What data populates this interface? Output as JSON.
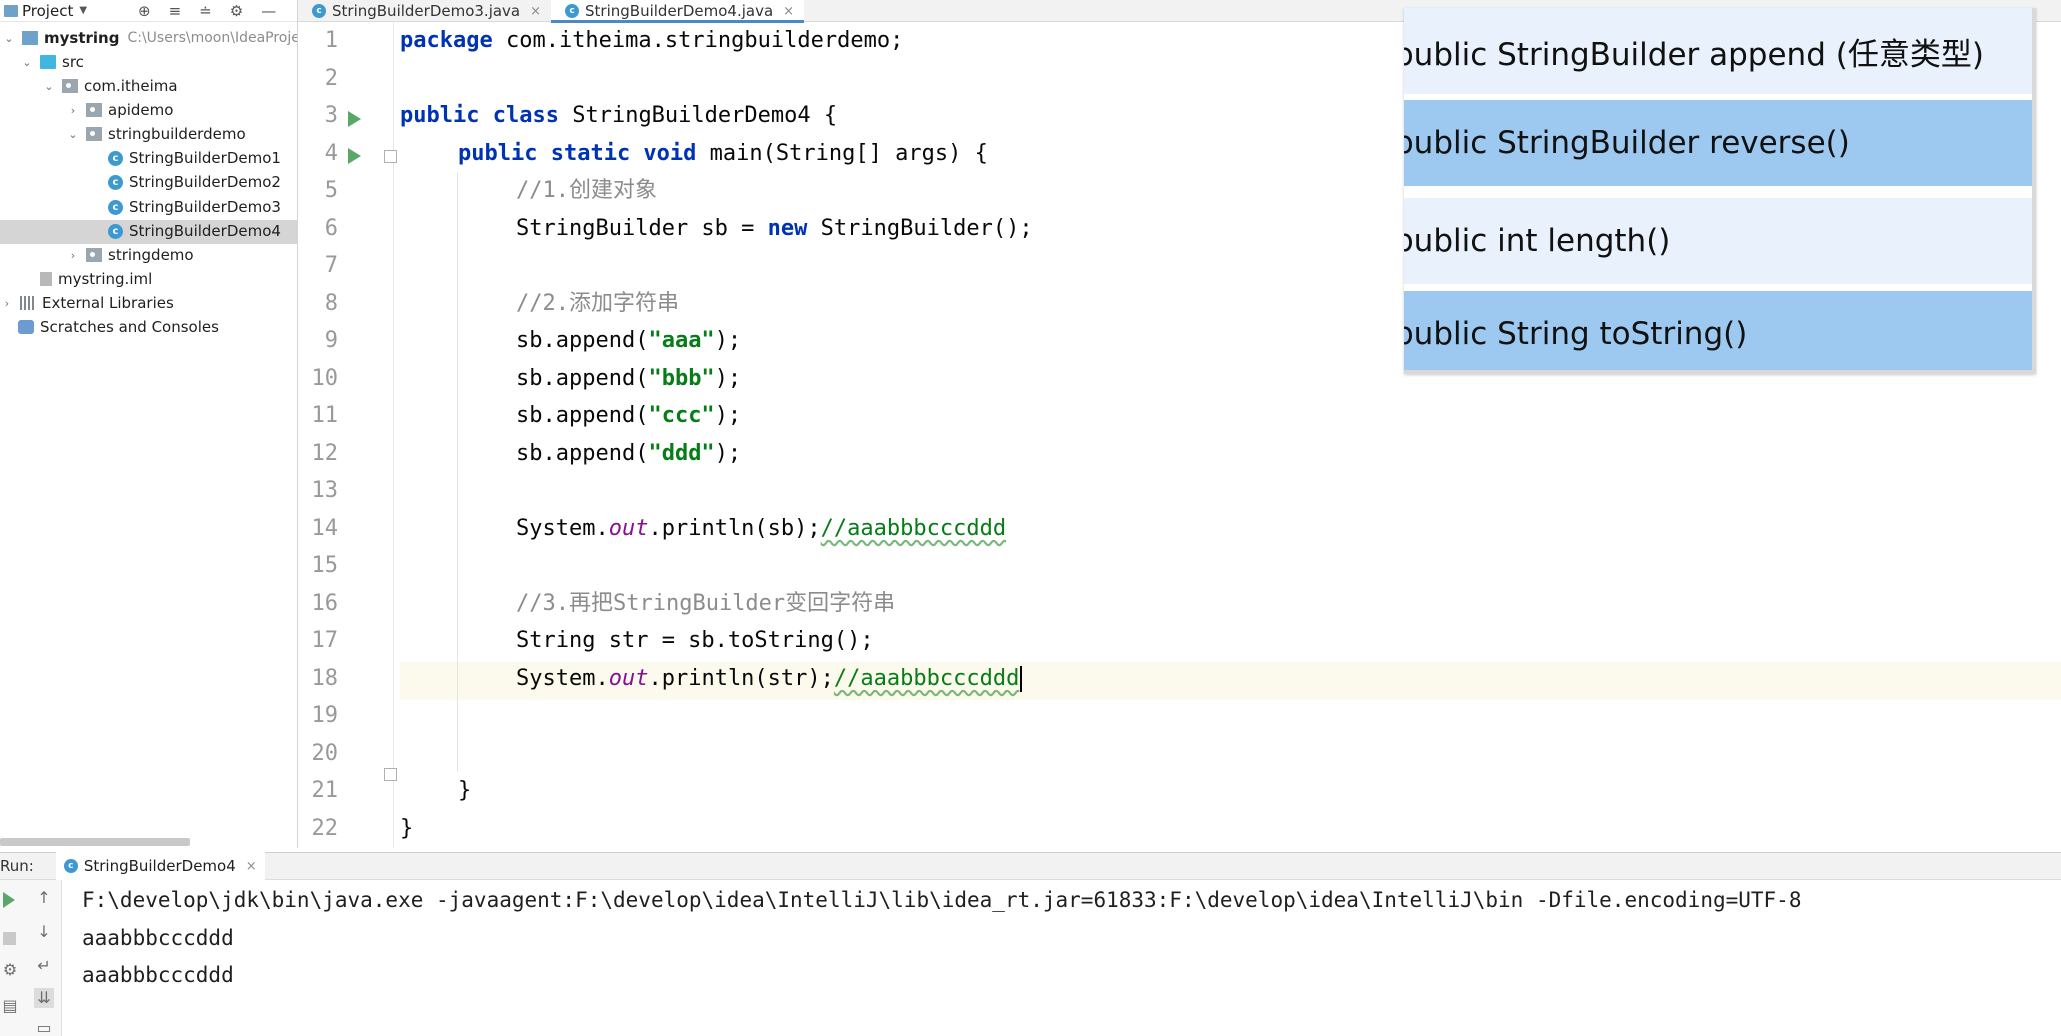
{
  "project_panel": {
    "title": "Project",
    "tree": [
      {
        "label": "mystring",
        "path_hint": "C:\\Users\\moon\\IdeaProjec"
      },
      {
        "label": "src"
      },
      {
        "label": "com.itheima"
      },
      {
        "label": "apidemo"
      },
      {
        "label": "stringbuilderdemo"
      },
      {
        "label": "StringBuilderDemo1"
      },
      {
        "label": "StringBuilderDemo2"
      },
      {
        "label": "StringBuilderDemo3"
      },
      {
        "label": "StringBuilderDemo4",
        "selected": true
      },
      {
        "label": "stringdemo"
      },
      {
        "label": "mystring.iml"
      },
      {
        "label": "External Libraries"
      },
      {
        "label": "Scratches and Consoles"
      }
    ]
  },
  "editor_tabs": [
    {
      "label": "StringBuilderDemo3.java",
      "active": false
    },
    {
      "label": "StringBuilderDemo4.java",
      "active": true
    }
  ],
  "code": {
    "line_numbers": [
      "1",
      "2",
      "3",
      "4",
      "5",
      "6",
      "7",
      "8",
      "9",
      "10",
      "11",
      "12",
      "13",
      "14",
      "15",
      "16",
      "17",
      "18",
      "19",
      "20",
      "21",
      "22"
    ],
    "tokens": {
      "package_kw": "package",
      "package_name": " com.itheima.stringbuilderdemo;",
      "public_kw": "public",
      "class_kw": " class",
      "class_decl": " StringBuilderDemo4 {",
      "public_static_void": "public static void",
      "main_sig": " main(String[] args) {",
      "comment1": "//1.创建对象",
      "sb_decl_a": "StringBuilder sb = ",
      "new_kw": "new",
      "sb_decl_b": " StringBuilder();",
      "comment2": "//2.添加字符串",
      "append_prefix": "sb.append(",
      "append_suffix": ");",
      "str_aaa": "\"aaa\"",
      "str_bbb": "\"bbb\"",
      "str_ccc": "\"ccc\"",
      "str_ddd": "\"ddd\"",
      "sysout_prefix": "System.",
      "out_field": "out",
      "println_sb": ".println(sb);",
      "println_str": ".println(str);",
      "trail_comment": "//aaabbbcccddd",
      "comment3": "//3.再把StringBuilder变回字符串",
      "str_decl": "String str = sb.toString();",
      "close_brace": "}"
    }
  },
  "overlay": {
    "items": [
      "public StringBuilder append (任意类型)",
      "public StringBuilder reverse()",
      "public int length()",
      "public String toString()"
    ]
  },
  "run_panel": {
    "label": "Run:",
    "tab_label": "StringBuilderDemo4",
    "console_lines": [
      "F:\\develop\\jdk\\bin\\java.exe -javaagent:F:\\develop\\idea\\IntelliJ\\lib\\idea_rt.jar=61833:F:\\develop\\idea\\IntelliJ\\bin -Dfile.encoding=UTF-8",
      "aaabbbcccddd",
      "aaabbbcccddd"
    ]
  },
  "colors": {
    "keyword": "#0033b3",
    "string": "#067d17",
    "comment": "#8c8c8c",
    "field": "#871094",
    "run_icon": "#59a869",
    "overlay_light": "#e8f1fc",
    "overlay_dark": "#9dc9f0",
    "selected_row": "#d5d5d5"
  },
  "icons": {
    "run": "run-gutter-icon",
    "fold": "fold-icon",
    "bulb": "intention-bulb-icon",
    "class": "java-class-icon",
    "folder": "folder-icon",
    "package": "package-icon"
  }
}
